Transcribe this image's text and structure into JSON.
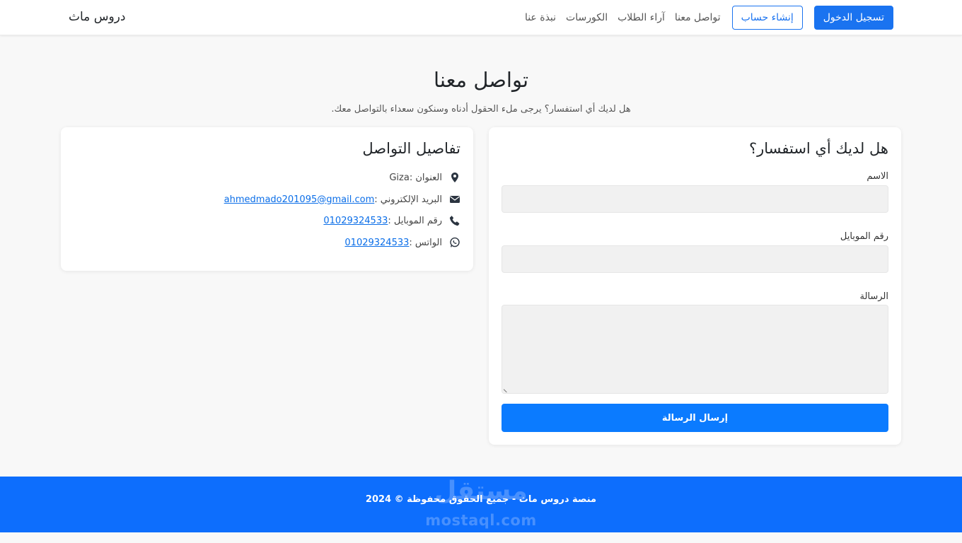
{
  "navbar": {
    "brand": "دروس ماث",
    "login_label": "تسجيل الدخول",
    "register_label": "إنشاء حساب",
    "links": [
      "تواصل معنا",
      "آراء الطلاب",
      "الكورسات",
      "نبذة عنا"
    ]
  },
  "header": {
    "title": "تواصل معنا",
    "subtitle": "هل لديك أي استفسار؟ يرجى ملء الحقول أدناه وسنكون سعداء بالتواصل معك."
  },
  "form": {
    "title": "هل لديك أي استفسار؟",
    "name_label": "الاسم",
    "name_value": "",
    "phone_label": "رقم الموبايل",
    "phone_value": "",
    "message_label": "الرسالة",
    "message_value": "",
    "submit_label": "إرسال الرسالة"
  },
  "contact_info": {
    "title": "تفاصيل التواصل",
    "address_label": "العنوان : ",
    "address_value": "Giza",
    "email_label": "البريد الإلكتروني :",
    "email_value": "ahmedmado201095@gmail.com",
    "mobile_label": "رقم الموبايل :",
    "mobile_value": "01029324533",
    "whatsapp_label": "الواتس :",
    "whatsapp_value": "01029324533"
  },
  "footer": {
    "text": "منصة دروس ماث - جميع الحقوق محفوظة © 2024"
  },
  "watermark": {
    "arabic": "مستقل",
    "latin": "mostaql.com"
  },
  "colors": {
    "primary": "#0d6efd",
    "button_blue": "#1a73f0",
    "link": "#0b6ee8",
    "icon": "#2b3440"
  },
  "icons": {
    "address": "map-marker-icon",
    "email": "envelope-icon",
    "mobile": "phone-icon",
    "whatsapp": "whatsapp-icon"
  }
}
